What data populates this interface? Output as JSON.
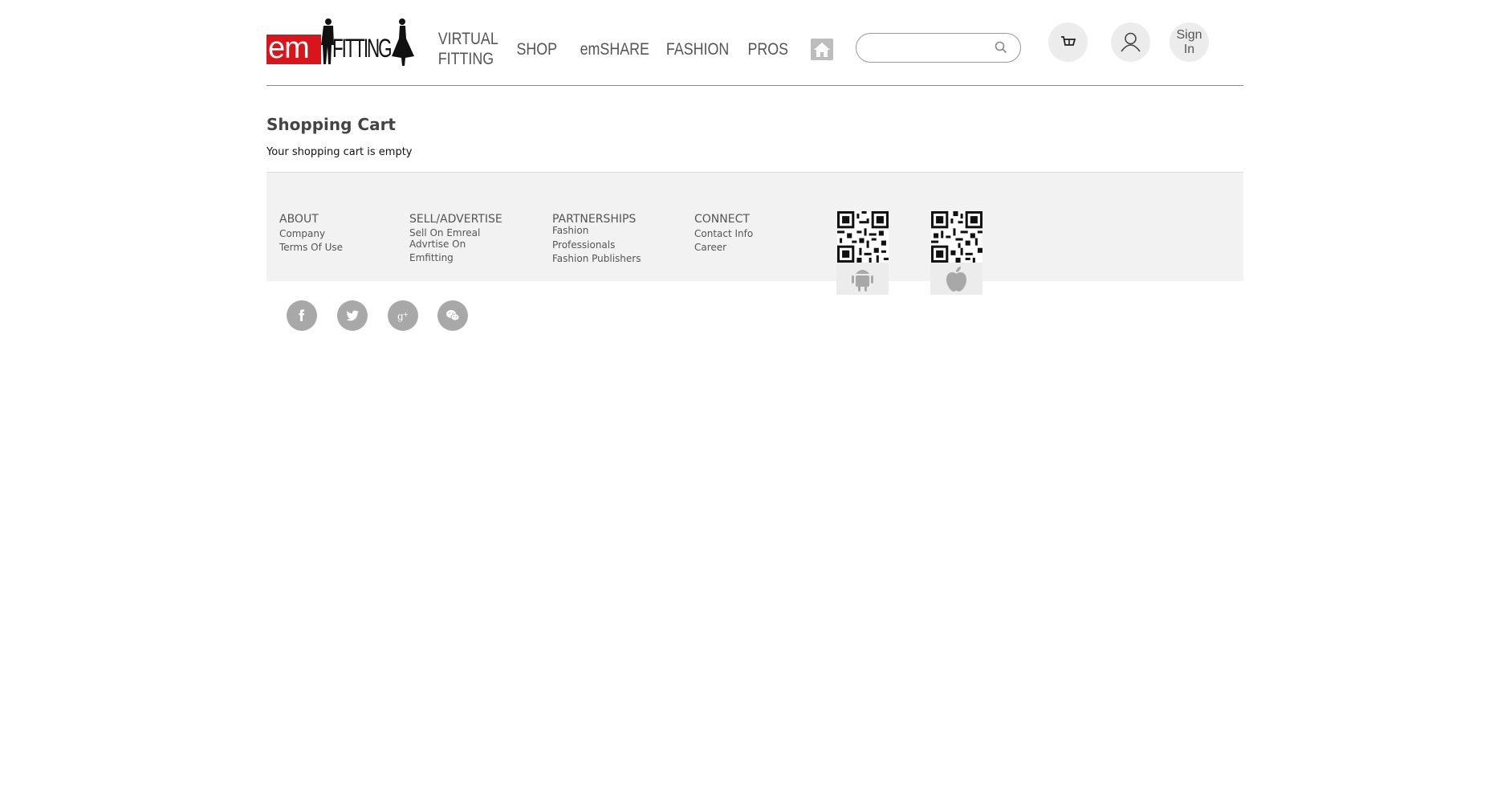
{
  "logo": {
    "em": "em",
    "fitting": "FITTING"
  },
  "nav": {
    "virtual_fitting": "VIRTUAL\nFITTING",
    "shop": "SHOP",
    "emshare": "emSHARE",
    "fashion": "FASHION",
    "pros": "PROS"
  },
  "search": {
    "value": "",
    "placeholder": ""
  },
  "header": {
    "sign_in": "Sign In"
  },
  "main": {
    "title": "Shopping Cart",
    "empty_message": "Your shopping cart is empty"
  },
  "footer": {
    "about": {
      "heading": "ABOUT",
      "links": [
        "Company",
        "Terms Of Use"
      ]
    },
    "sell": {
      "heading": "SELL/ADVERTISE",
      "links": [
        "Sell On Emreal",
        "Advrtise On",
        "Emfitting"
      ]
    },
    "partnerships": {
      "heading": "PARTNERSHIPS",
      "links": [
        "Fashion",
        "Professionals",
        "Fashion Publishers"
      ]
    },
    "connect": {
      "heading": "CONNECT",
      "links": [
        "Contact Info",
        "Career"
      ]
    }
  },
  "icons": {
    "home": "home-icon",
    "cart": "cart-icon",
    "user": "user-icon",
    "search": "search-icon",
    "android": "android-icon",
    "apple": "apple-icon",
    "social": [
      "facebook-icon",
      "twitter-icon",
      "google-plus-icon",
      "wechat-icon"
    ]
  },
  "colors": {
    "brand_red": "#d9141b",
    "nav_text": "#555555",
    "footer_bg": "#f2f2f2",
    "social_bg": "#a8a8a8"
  }
}
